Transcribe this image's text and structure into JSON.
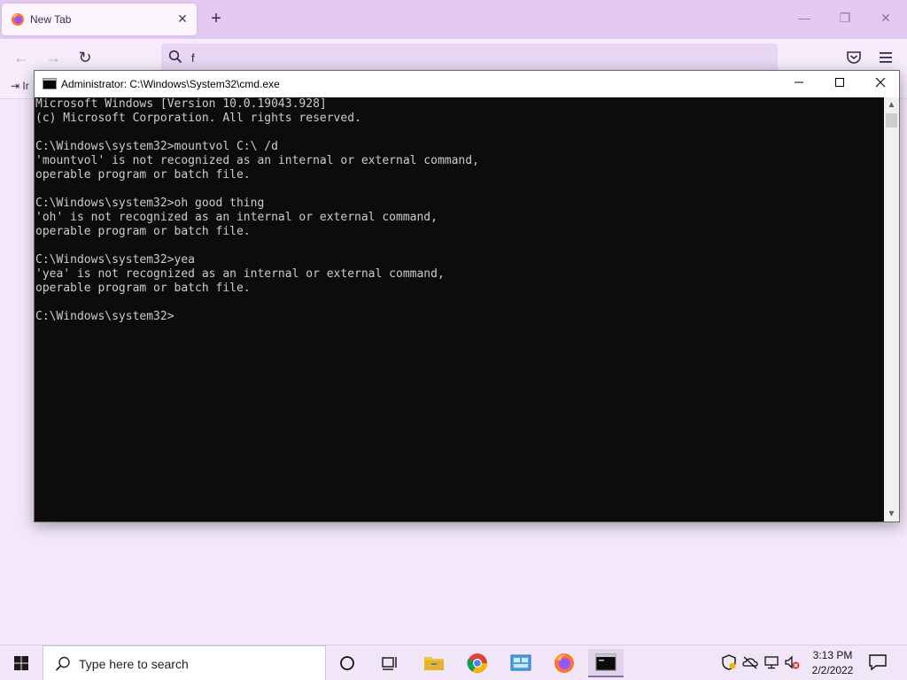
{
  "browser": {
    "tab_title": "New Tab",
    "url_value": "f",
    "bookmark_import": "Ir"
  },
  "cmd": {
    "window_title": "Administrator: C:\\Windows\\System32\\cmd.exe",
    "lines": [
      "Microsoft Windows [Version 10.0.19043.928]",
      "(c) Microsoft Corporation. All rights reserved.",
      "",
      "C:\\Windows\\system32>mountvol C:\\ /d",
      "'mountvol' is not recognized as an internal or external command,",
      "operable program or batch file.",
      "",
      "C:\\Windows\\system32>oh good thing",
      "'oh' is not recognized as an internal or external command,",
      "operable program or batch file.",
      "",
      "C:\\Windows\\system32>yea",
      "'yea' is not recognized as an internal or external command,",
      "operable program or batch file.",
      "",
      "C:\\Windows\\system32>"
    ]
  },
  "taskbar": {
    "search_placeholder": "Type here to search",
    "time": "3:13 PM",
    "date": "2/2/2022"
  },
  "colors": {
    "accent": "#e4c9f3",
    "console_bg": "#0c0c0c",
    "console_fg": "#cccccc"
  }
}
